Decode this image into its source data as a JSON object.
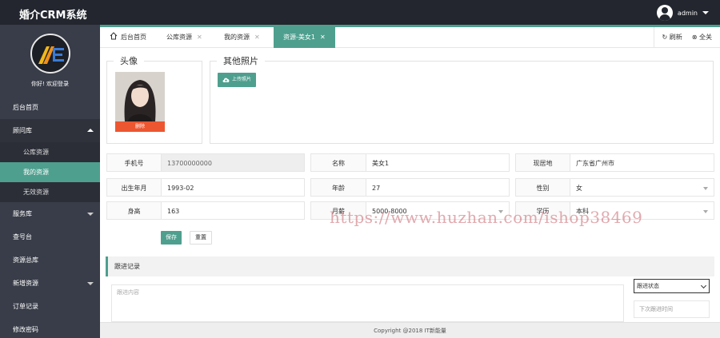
{
  "header": {
    "app_title": "婚介CRM系统",
    "username": "admin"
  },
  "sidebar": {
    "welcome": "你好! 欢迎登录",
    "items": [
      {
        "label": "后台首页"
      },
      {
        "label": "顾问库"
      },
      {
        "label": "公库资源"
      },
      {
        "label": "我的资源"
      },
      {
        "label": "无效资源"
      },
      {
        "label": "服务库"
      },
      {
        "label": "查号台"
      },
      {
        "label": "资源总库"
      },
      {
        "label": "新增资源"
      },
      {
        "label": "订单记录"
      },
      {
        "label": "修改密码"
      }
    ]
  },
  "tabs": {
    "items": [
      {
        "label": "后台首页"
      },
      {
        "label": "公库资源"
      },
      {
        "label": "我的资源"
      },
      {
        "label": "资源-美女1"
      }
    ],
    "refresh": "刷新",
    "close_all": "全关"
  },
  "avatar_section": {
    "legend": "头像",
    "delete_label": "删除"
  },
  "photos_section": {
    "legend": "其他照片",
    "upload_label": "上传照片"
  },
  "form": {
    "phone_label": "手机号",
    "phone_value": "13700000000",
    "name_label": "名称",
    "name_value": "美女1",
    "residence_label": "现居地",
    "residence_value": "广东省广州市",
    "birth_label": "出生年月",
    "birth_value": "1993-02",
    "age_label": "年龄",
    "age_value": "27",
    "gender_label": "性别",
    "gender_value": "女",
    "height_label": "身高",
    "height_value": "163",
    "salary_label": "月薪",
    "salary_value": "5000-8000",
    "education_label": "学历",
    "education_value": "本科",
    "save_label": "保存",
    "reset_label": "重置"
  },
  "follow": {
    "title": "跟进记录",
    "content_placeholder": "跟进内容",
    "status_label": "跟进状态",
    "next_time_placeholder": "下次跟进时间"
  },
  "footer": {
    "copyright": "Copyright @2018 IT新能量"
  },
  "watermark": "https://www.huzhan.com/ishop38469",
  "colors": {
    "accent": "#4e9f8e",
    "header_bg": "#23262e",
    "sidebar_bg": "#393d49",
    "danger": "#ec5631"
  }
}
